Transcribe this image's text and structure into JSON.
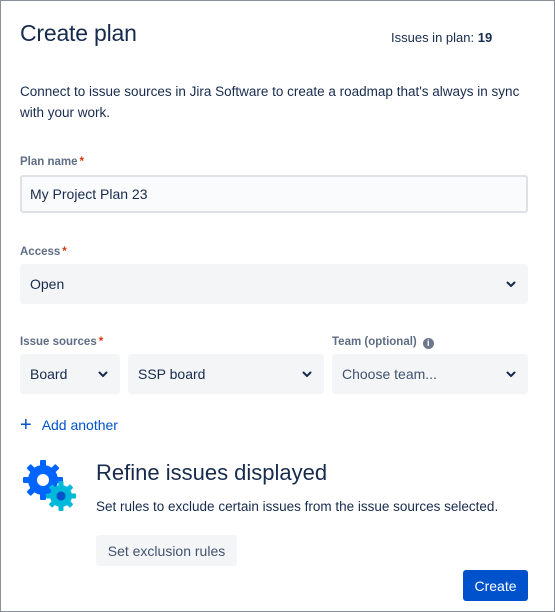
{
  "header": {
    "title": "Create plan",
    "issues_label": "Issues in plan:",
    "issues_count": "19"
  },
  "description": "Connect to issue sources in Jira Software to create a roadmap that's always in sync with your work.",
  "form": {
    "plan_name": {
      "label": "Plan name",
      "required_mark": "*",
      "value": "My Project Plan 23"
    },
    "access": {
      "label": "Access",
      "required_mark": "*",
      "selected": "Open"
    },
    "issue_sources": {
      "label": "Issue sources",
      "required_mark": "*",
      "source_type": "Board",
      "source": "SSP board"
    },
    "team": {
      "label": "Team (optional)",
      "info_glyph": "i",
      "placeholder": "Choose team..."
    },
    "add_another": {
      "icon": "+",
      "label": "Add another"
    }
  },
  "refine": {
    "title": "Refine issues displayed",
    "description": "Set rules to exclude certain issues from the issue sources selected.",
    "button": "Set exclusion rules"
  },
  "actions": {
    "create": "Create"
  },
  "colors": {
    "primary": "#0052CC",
    "text": "#172B4D",
    "label": "#5E6C84",
    "required": "#DE350B",
    "field_bg": "#F4F5F7"
  }
}
